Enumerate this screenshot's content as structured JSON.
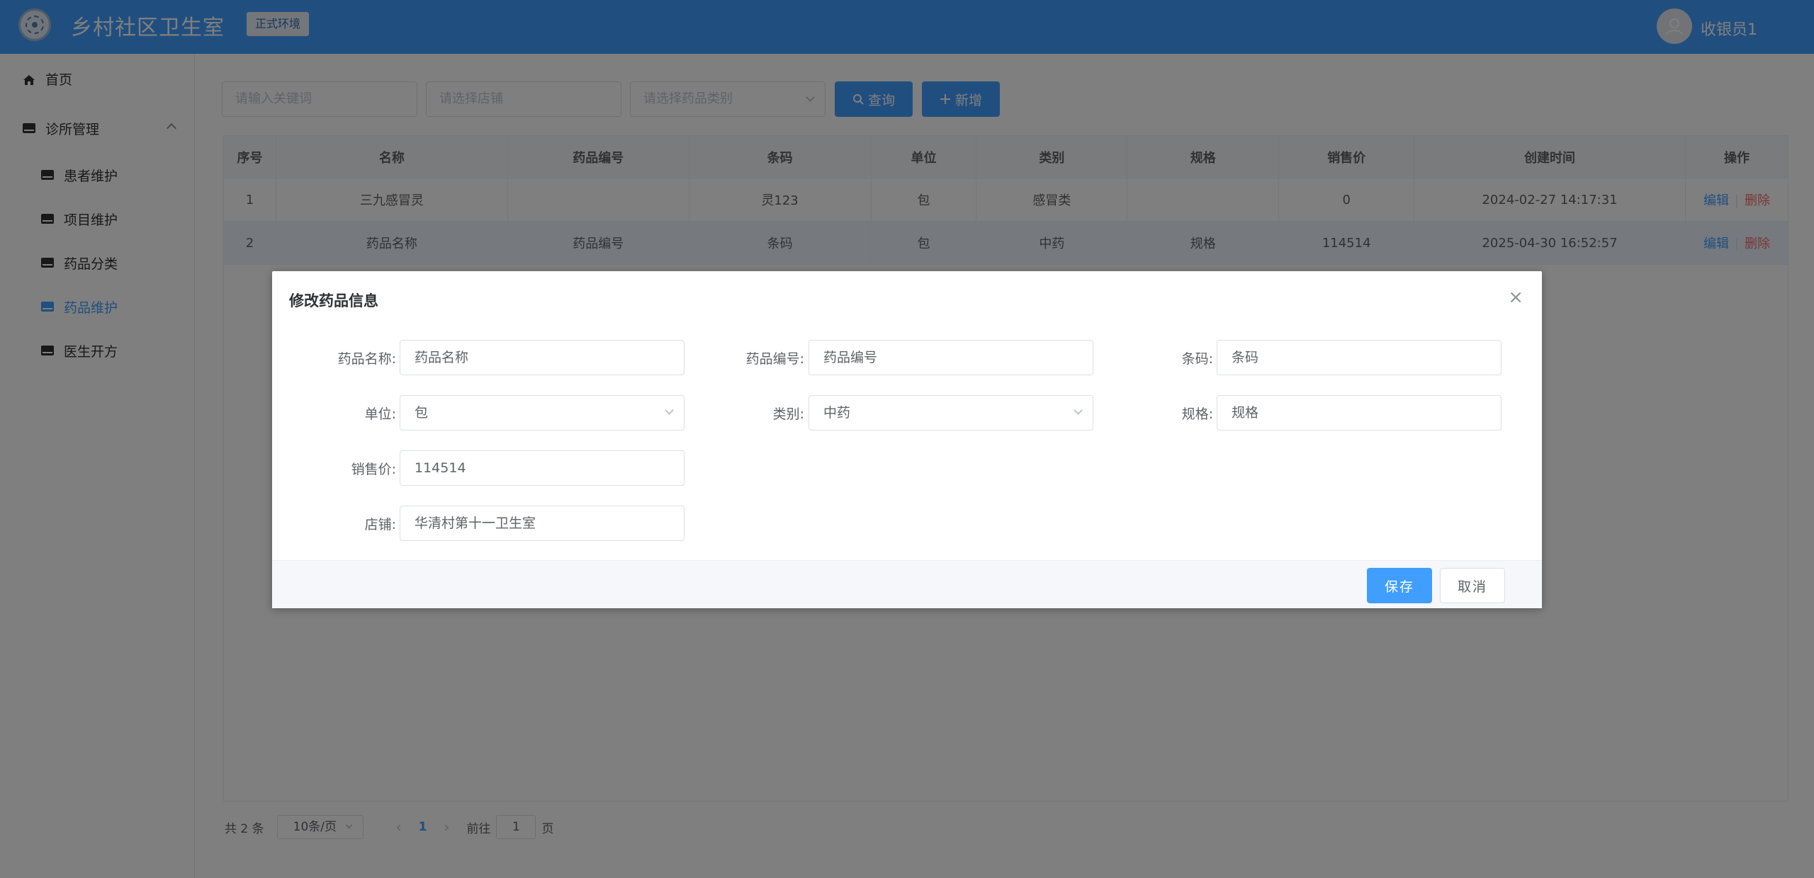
{
  "header": {
    "title": "乡村社区卫生室",
    "env_badge": "正式环境",
    "user_name": "收银员1",
    "logo_icon": "logo-icon",
    "avatar_icon": "user-avatar-icon",
    "color": "#409eff"
  },
  "sidebar": {
    "home": "首页",
    "clinic_group": "诊所管理",
    "items": [
      {
        "label": "患者维护",
        "active": false
      },
      {
        "label": "项目维护",
        "active": false
      },
      {
        "label": "药品分类",
        "active": false
      },
      {
        "label": "药品维护",
        "active": true
      },
      {
        "label": "医生开方",
        "active": false
      }
    ]
  },
  "toolbar": {
    "keyword_placeholder": "请输入关键词",
    "store_placeholder": "请选择店铺",
    "category_placeholder": "请选择药品类别",
    "query_label": "查询",
    "add_label": "新增"
  },
  "table": {
    "columns": [
      "序号",
      "名称",
      "药品编号",
      "条码",
      "单位",
      "类别",
      "规格",
      "销售价",
      "创建时间",
      "操作"
    ],
    "rows": [
      {
        "no": "1",
        "name": "三九感冒灵",
        "code": "",
        "barcode": "灵123",
        "unit": "包",
        "category": "感冒类",
        "spec": "",
        "price": "0",
        "created": "2024-02-27 14:17:31"
      },
      {
        "no": "2",
        "name": "药品名称",
        "code": "药品编号",
        "barcode": "条码",
        "unit": "包",
        "category": "中药",
        "spec": "规格",
        "price": "114514",
        "created": "2025-04-30 16:52:57"
      }
    ],
    "edit_label": "编辑",
    "delete_label": "删除"
  },
  "pagination": {
    "total": "共 2 条",
    "page_size": "10条/页",
    "current_page": "1",
    "goto_prefix": "前往",
    "goto_value": "1",
    "goto_suffix": "页"
  },
  "dialog": {
    "title": "修改药品信息",
    "fields": {
      "name_label": "药品名称:",
      "name_value": "药品名称",
      "code_label": "药品编号:",
      "code_value": "药品编号",
      "barcode_label": "条码:",
      "barcode_value": "条码",
      "unit_label": "单位:",
      "unit_value": "包",
      "category_label": "类别:",
      "category_value": "中药",
      "spec_label": "规格:",
      "spec_value": "规格",
      "price_label": "销售价:",
      "price_value": "114514",
      "store_label": "店铺:",
      "store_value": "华清村第十一卫生室"
    },
    "save_label": "保存",
    "cancel_label": "取消"
  }
}
